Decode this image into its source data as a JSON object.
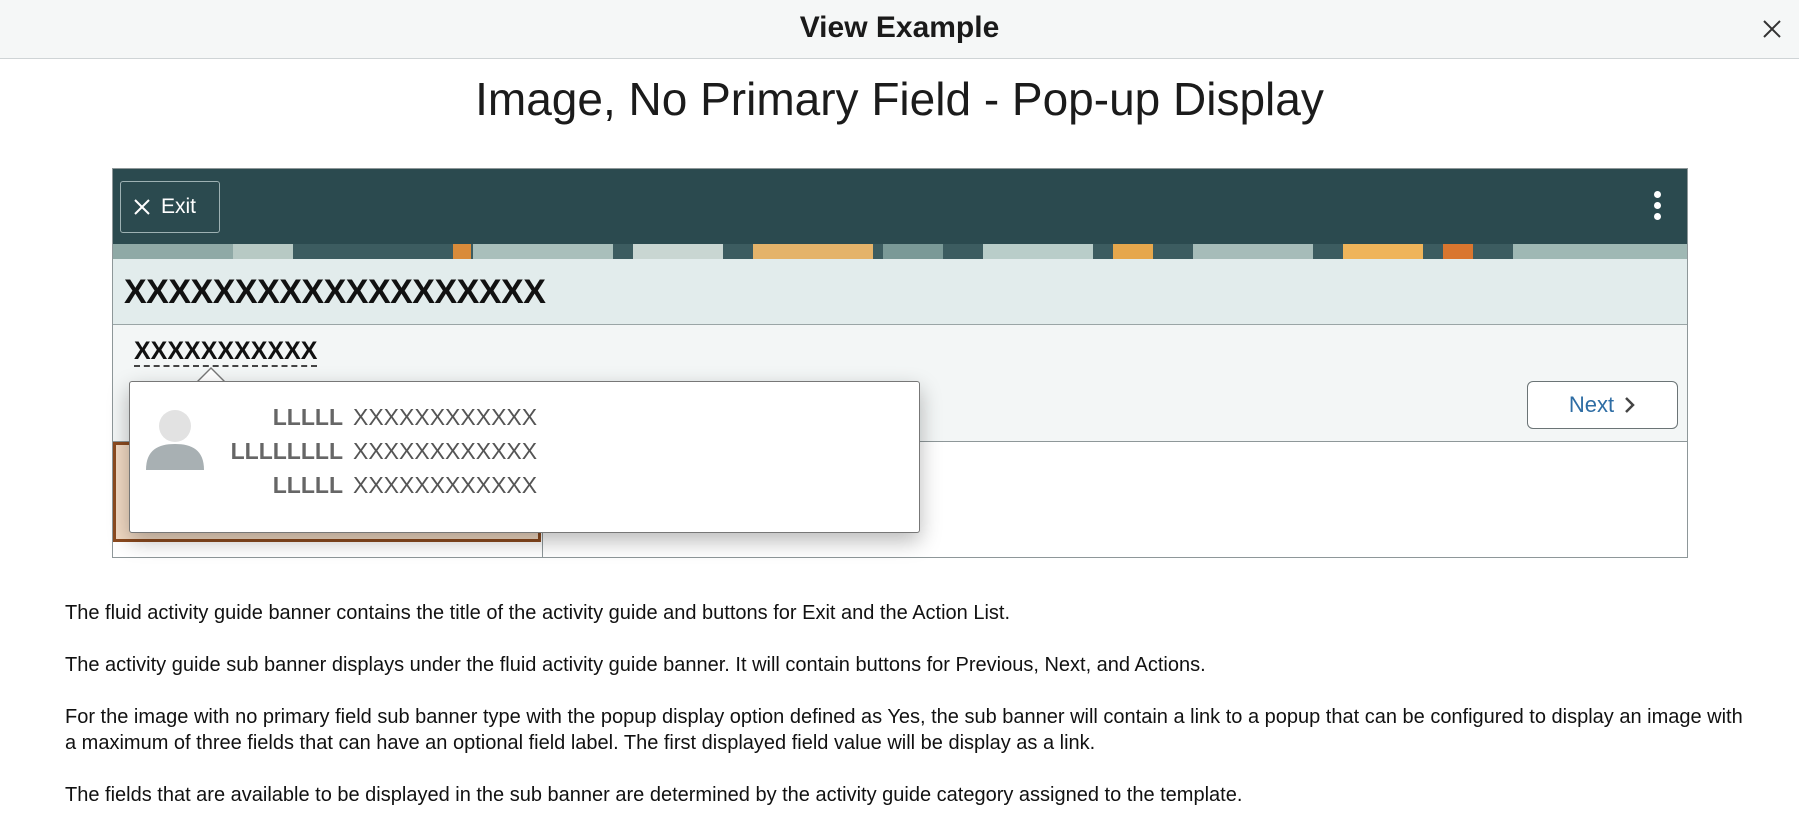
{
  "dialog": {
    "title": "View Example",
    "close_icon": "close-icon"
  },
  "page": {
    "heading": "Image, No Primary Field - Pop-up Display"
  },
  "banner": {
    "exit_label": "Exit",
    "title": "XXXXXXXXXXXXXXXXXXX",
    "actions_icon": "kebab-menu-icon",
    "colors": {
      "banner": "#2b4a4f",
      "title_band": "#e2ecec",
      "sub_band": "#f3f6f6"
    }
  },
  "sub_banner": {
    "link_text": "XXXXXXXXXXX",
    "next_label": "Next"
  },
  "popup": {
    "avatar_icon": "person-avatar-icon",
    "fields": [
      {
        "label": "LLLLL",
        "value": "XXXXXXXXXXXX"
      },
      {
        "label": "LLLLLLLL",
        "value": "XXXXXXXXXXXX"
      },
      {
        "label": "LLLLL",
        "value": "XXXXXXXXXXXX"
      }
    ]
  },
  "description": [
    "The fluid activity guide banner contains the title of the activity guide and buttons for Exit and the Action List.",
    "The activity guide sub banner displays under the fluid activity guide banner.  It will contain buttons for Previous, Next, and Actions.",
    "For the image with no primary field sub banner type with the popup display option defined as Yes, the sub banner will contain a link to a popup that can be configured to display an image with a maximum of three fields that can have an optional field label.  The first displayed field value will be display as a link.",
    "The fields that are available to be displayed in the sub banner are determined by the activity guide category assigned to the template."
  ]
}
